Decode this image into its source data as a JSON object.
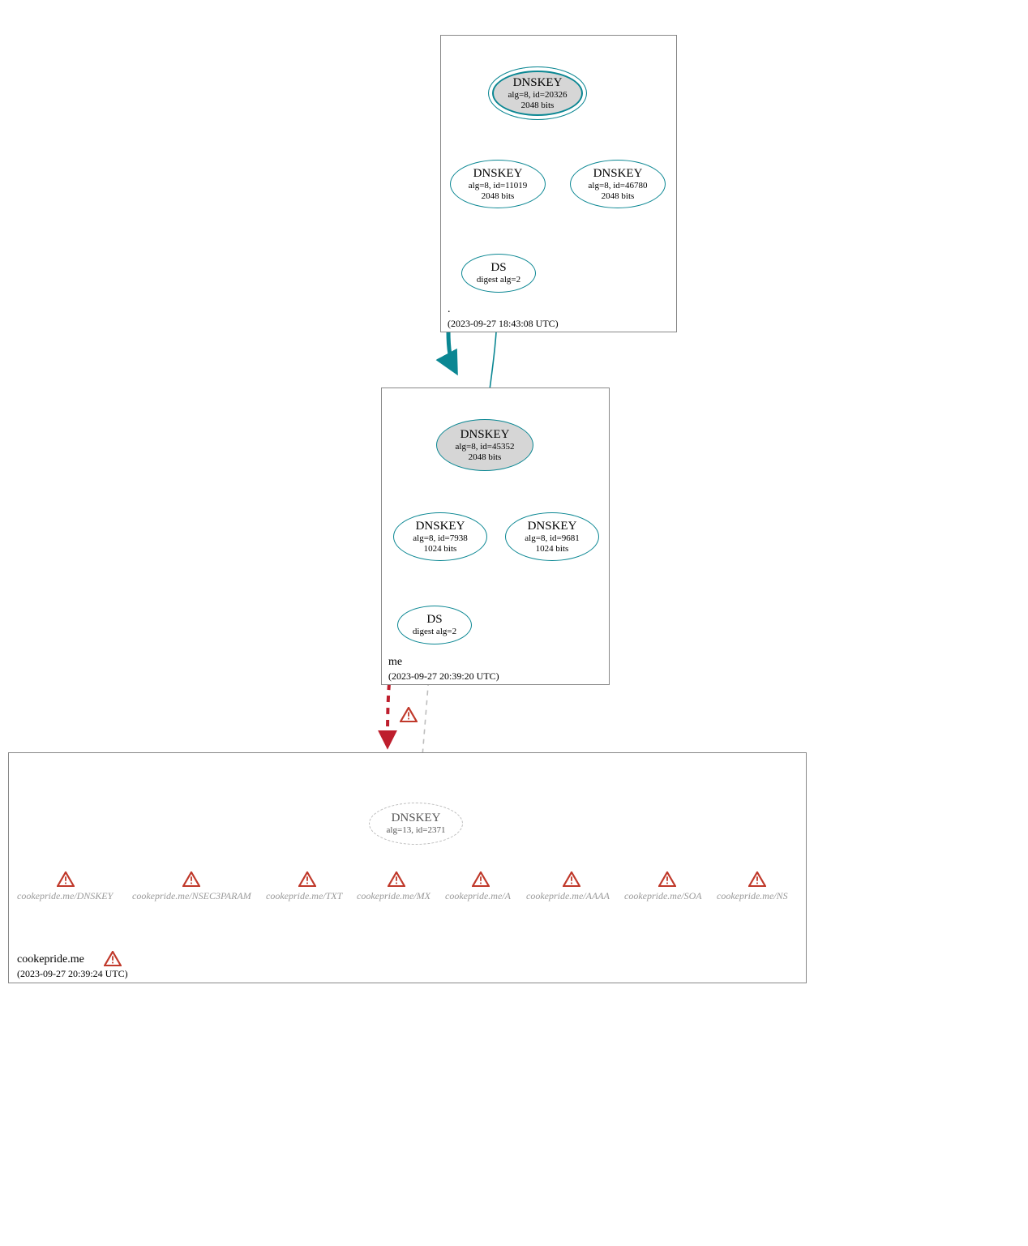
{
  "chart_data": {
    "type": "diagram",
    "title": "DNSSEC Authentication Chain",
    "zones": [
      {
        "id": "root",
        "name": ".",
        "timestamp": "(2023-09-27 18:43:08 UTC)"
      },
      {
        "id": "me",
        "name": "me",
        "timestamp": "(2023-09-27 20:39:20 UTC)"
      },
      {
        "id": "cookepride",
        "name": "cookepride.me",
        "timestamp": "(2023-09-27 20:39:24 UTC)"
      }
    ],
    "nodes": [
      {
        "id": "root_ksk",
        "zone": "root",
        "type": "DNSKEY",
        "alg": 8,
        "keyid": 20326,
        "bits": 2048,
        "ksk": true
      },
      {
        "id": "root_zsk1",
        "zone": "root",
        "type": "DNSKEY",
        "alg": 8,
        "keyid": 11019,
        "bits": 2048
      },
      {
        "id": "root_zsk2",
        "zone": "root",
        "type": "DNSKEY",
        "alg": 8,
        "keyid": 46780,
        "bits": 2048
      },
      {
        "id": "root_ds",
        "zone": "root",
        "type": "DS",
        "digest_alg": 2
      },
      {
        "id": "me_ksk",
        "zone": "me",
        "type": "DNSKEY",
        "alg": 8,
        "keyid": 45352,
        "bits": 2048,
        "ksk": true
      },
      {
        "id": "me_zsk1",
        "zone": "me",
        "type": "DNSKEY",
        "alg": 8,
        "keyid": 7938,
        "bits": 1024
      },
      {
        "id": "me_zsk2",
        "zone": "me",
        "type": "DNSKEY",
        "alg": 8,
        "keyid": 9681,
        "bits": 1024
      },
      {
        "id": "me_ds",
        "zone": "me",
        "type": "DS",
        "digest_alg": 2
      },
      {
        "id": "cp_dnskey",
        "zone": "cookepride",
        "type": "DNSKEY",
        "alg": 13,
        "keyid": 2371,
        "dashed": true
      }
    ],
    "edges": [
      {
        "from": "root_ksk",
        "to": "root_ksk",
        "style": "self"
      },
      {
        "from": "root_ksk",
        "to": "root_zsk1",
        "style": "solid"
      },
      {
        "from": "root_ksk",
        "to": "root_zsk2",
        "style": "solid"
      },
      {
        "from": "root_zsk1",
        "to": "root_ds",
        "style": "solid"
      },
      {
        "from": "root_ds",
        "to": "me_ksk",
        "style": "solid"
      },
      {
        "from": "root_box",
        "to": "me_box",
        "style": "thick"
      },
      {
        "from": "me_ksk",
        "to": "me_ksk",
        "style": "self"
      },
      {
        "from": "me_ksk",
        "to": "me_zsk1",
        "style": "solid"
      },
      {
        "from": "me_ksk",
        "to": "me_zsk2",
        "style": "solid"
      },
      {
        "from": "me_zsk1",
        "to": "me_ds",
        "style": "solid"
      },
      {
        "from": "me_ds",
        "to": "cp_dnskey",
        "style": "dashed-grey"
      },
      {
        "from": "me_box",
        "to": "cp_box",
        "style": "dashed-red",
        "warning": true
      }
    ],
    "rrsets": [
      {
        "label": "cookepride.me/DNSKEY",
        "status": "warning"
      },
      {
        "label": "cookepride.me/NSEC3PARAM",
        "status": "warning"
      },
      {
        "label": "cookepride.me/TXT",
        "status": "warning"
      },
      {
        "label": "cookepride.me/MX",
        "status": "warning"
      },
      {
        "label": "cookepride.me/A",
        "status": "warning"
      },
      {
        "label": "cookepride.me/AAAA",
        "status": "warning"
      },
      {
        "label": "cookepride.me/SOA",
        "status": "warning"
      },
      {
        "label": "cookepride.me/NS",
        "status": "warning"
      }
    ],
    "zone_warnings": [
      {
        "zone": "cookepride",
        "status": "warning"
      }
    ]
  },
  "labels": {
    "dnskey": "DNSKEY",
    "ds": "DS",
    "root_ksk_sub": "alg=8, id=20326",
    "root_ksk_bits": "2048 bits",
    "root_zsk1_sub": "alg=8, id=11019",
    "root_zsk1_bits": "2048 bits",
    "root_zsk2_sub": "alg=8, id=46780",
    "root_zsk2_bits": "2048 bits",
    "root_ds_sub": "digest alg=2",
    "me_ksk_sub": "alg=8, id=45352",
    "me_ksk_bits": "2048 bits",
    "me_zsk1_sub": "alg=8, id=7938",
    "me_zsk1_bits": "1024 bits",
    "me_zsk2_sub": "alg=8, id=9681",
    "me_zsk2_bits": "1024 bits",
    "me_ds_sub": "digest alg=2",
    "cp_dnskey_sub": "alg=13, id=2371",
    "zone_root_name": ".",
    "zone_root_ts": "(2023-09-27 18:43:08 UTC)",
    "zone_me_name": "me",
    "zone_me_ts": "(2023-09-27 20:39:20 UTC)",
    "zone_cp_name": "cookepride.me",
    "zone_cp_ts": "(2023-09-27 20:39:24 UTC)",
    "rr0": "cookepride.me/DNSKEY",
    "rr1": "cookepride.me/NSEC3PARAM",
    "rr2": "cookepride.me/TXT",
    "rr3": "cookepride.me/MX",
    "rr4": "cookepride.me/A",
    "rr5": "cookepride.me/AAAA",
    "rr6": "cookepride.me/SOA",
    "rr7": "cookepride.me/NS"
  }
}
